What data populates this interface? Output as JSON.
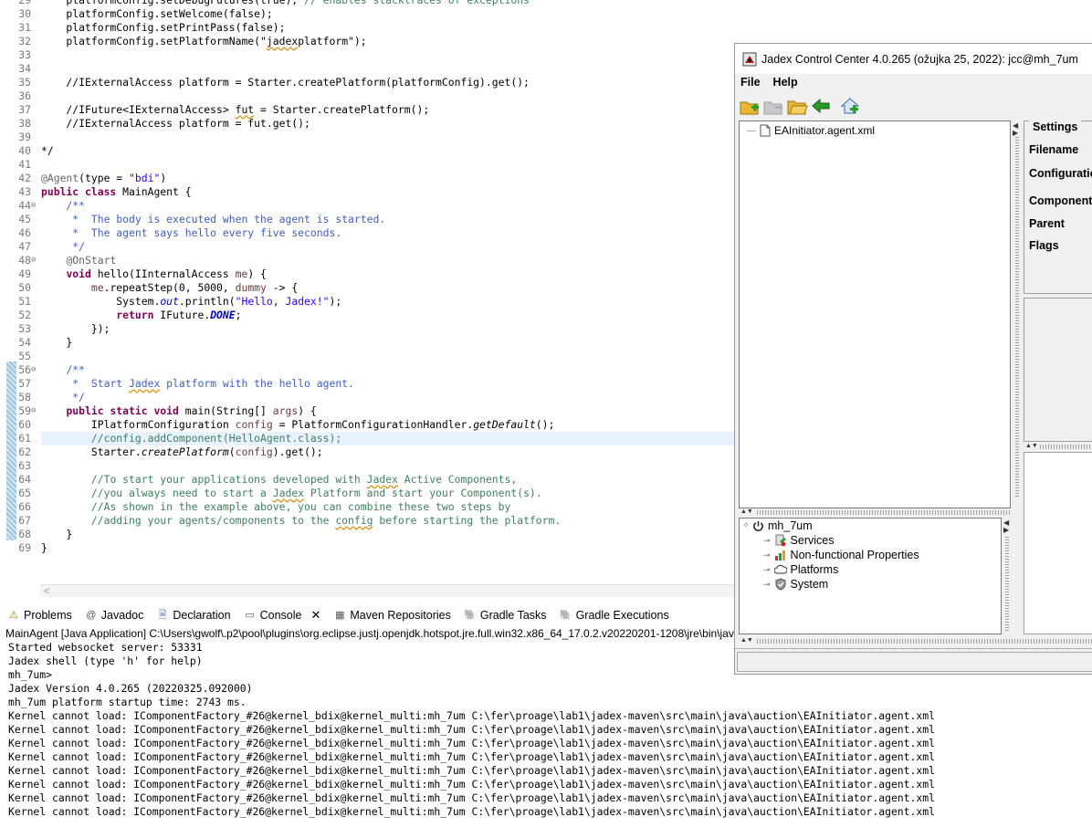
{
  "editor": {
    "lines": [
      {
        "n": "29",
        "html": "    platformConfig.setDebugFutures(true); <span class=\"cm\">// enables stacktraces of exceptions</span>"
      },
      {
        "n": "30",
        "html": "    platformConfig.setWelcome(false);"
      },
      {
        "n": "31",
        "html": "    platformConfig.setPrintPass(false);"
      },
      {
        "n": "32",
        "html": "    platformConfig.setPlatformName(\"<span class=\"sq\">jadex</span>platform\");"
      },
      {
        "n": "33",
        "html": ""
      },
      {
        "n": "34",
        "html": ""
      },
      {
        "n": "35",
        "html": "    //IExternalAccess platform = Starter.createPlatform(platformConfig).get();"
      },
      {
        "n": "36",
        "html": ""
      },
      {
        "n": "37",
        "html": "    //IFuture&lt;IExternalAccess&gt; <span class=\"sq\">fut</span> = Starter.createPlatform();"
      },
      {
        "n": "38",
        "html": "    //IExternalAccess platform = fut.get();"
      },
      {
        "n": "39",
        "html": ""
      },
      {
        "n": "40",
        "html": "*/"
      },
      {
        "n": "41",
        "html": ""
      },
      {
        "n": "42",
        "html": "<span class=\"an\">@Agent</span>(type = <span class=\"st\">\"bdi\"</span>)"
      },
      {
        "n": "43",
        "html": "<span class=\"kw\">public class</span> MainAgent {"
      },
      {
        "n": "44",
        "fold": "⊖",
        "html": "    <span class=\"jd\">/**</span>"
      },
      {
        "n": "45",
        "html": "    <span class=\"jd\"> *  The body is executed when the agent is started.</span>"
      },
      {
        "n": "46",
        "html": "    <span class=\"jd\"> *  The agent says hello every five seconds.</span>"
      },
      {
        "n": "47",
        "html": "    <span class=\"jd\"> */</span>"
      },
      {
        "n": "48",
        "fold": "⊖",
        "html": "    <span class=\"an\">@OnStart</span>"
      },
      {
        "n": "49",
        "html": "    <span class=\"kw\">void</span> hello(IInternalAccess <span class=\"va\">me</span>) {"
      },
      {
        "n": "50",
        "html": "        <span class=\"va\">me</span>.repeatStep(0, 5000, <span class=\"va\">dummy</span> -&gt; {"
      },
      {
        "n": "51",
        "html": "            System.<span class=\"fi\">out</span>.println(<span class=\"st\">\"Hello, Jadex!\"</span>);"
      },
      {
        "n": "52",
        "html": "            <span class=\"kw\">return</span> IFuture.<span class=\"fi\"><b>DONE</b></span>;"
      },
      {
        "n": "53",
        "html": "        });"
      },
      {
        "n": "54",
        "html": "    }"
      },
      {
        "n": "55",
        "html": ""
      },
      {
        "n": "56",
        "fold": "⊖",
        "html": "    <span class=\"jd\">/**</span>"
      },
      {
        "n": "57",
        "html": "    <span class=\"jd\"> *  Start <span class=\"sq\">Jadex</span> platform with the hello agent.</span>"
      },
      {
        "n": "58",
        "html": "    <span class=\"jd\"> */</span>"
      },
      {
        "n": "59",
        "fold": "⊖",
        "html": "    <span class=\"kw\">public static void</span> main(String[] <span class=\"va\">args</span>) {"
      },
      {
        "n": "60",
        "html": "        IPlatformConfiguration <span class=\"va\">config</span> = PlatformConfigurationHandler.<span class=\"mi\">getDefault</span>();"
      },
      {
        "n": "61",
        "hl": true,
        "html": "        <span class=\"cm\">//config.addComponent(HelloAgent.class);</span>"
      },
      {
        "n": "62",
        "html": "        Starter.<span class=\"mi\">createPlatform</span>(<span class=\"va\">config</span>).get();"
      },
      {
        "n": "63",
        "html": ""
      },
      {
        "n": "64",
        "html": "        <span class=\"cm\">//To start your applications developed with <span class=\"sq\">Jadex</span> Active Components,</span>"
      },
      {
        "n": "65",
        "html": "        <span class=\"cm\">//you always need to start a <span class=\"sq\">Jadex</span> Platform and start your Component(s).</span>"
      },
      {
        "n": "66",
        "html": "        <span class=\"cm\">//As shown in the example above, you can combine these two steps by</span>"
      },
      {
        "n": "67",
        "html": "        <span class=\"cm\">//adding your agents/components to the <span class=\"sq\">config</span> before starting the platform.</span>"
      },
      {
        "n": "68",
        "html": "    }"
      },
      {
        "n": "69",
        "html": "}"
      }
    ],
    "scroll_arrow": "<"
  },
  "views": {
    "tabs": [
      {
        "label": "Problems",
        "icon": "problems-icon",
        "glyph": "⚠",
        "color": "#c07000"
      },
      {
        "label": "Javadoc",
        "icon": "javadoc-icon",
        "glyph": "@",
        "color": "#555555"
      },
      {
        "label": "Declaration",
        "icon": "declaration-icon",
        "glyph": "🗎",
        "color": "#3c6ea8"
      },
      {
        "label": "Console",
        "icon": "console-icon",
        "glyph": "▭",
        "color": "#2f5b8a",
        "active": true
      },
      {
        "label": "Maven Repositories",
        "icon": "maven-icon",
        "glyph": "▦",
        "color": "#555555"
      },
      {
        "label": "Gradle Tasks",
        "icon": "gradle-tasks-icon",
        "glyph": "🐘",
        "color": "#1f4f4f"
      },
      {
        "label": "Gradle Executions",
        "icon": "gradle-executions-icon",
        "glyph": "🐘",
        "color": "#1f4f4f"
      }
    ],
    "close_glyph": "✕"
  },
  "console": {
    "header": "MainAgent [Java Application] C:\\Users\\gwolf\\.p2\\pool\\plugins\\org.eclipse.justj.openjdk.hotspot.jre.full.win32.x86_64_17.0.2.v20220201-1208\\jre\\bin\\javaw.exe",
    "lines": [
      "Started websocket server: 53331",
      "Jadex shell (type 'h' for help)",
      "mh_7um>",
      "Jadex Version 4.0.265 (20220325.092000)",
      "mh_7um platform startup time: 2743 ms.",
      "Kernel cannot load: IComponentFactory_#26@kernel_bdix@kernel_multi:mh_7um C:\\fer\\proage\\lab1\\jadex-maven\\src\\main\\java\\auction\\EAInitiator.agent.xml",
      "Kernel cannot load: IComponentFactory_#26@kernel_bdix@kernel_multi:mh_7um C:\\fer\\proage\\lab1\\jadex-maven\\src\\main\\java\\auction\\EAInitiator.agent.xml",
      "Kernel cannot load: IComponentFactory_#26@kernel_bdix@kernel_multi:mh_7um C:\\fer\\proage\\lab1\\jadex-maven\\src\\main\\java\\auction\\EAInitiator.agent.xml",
      "Kernel cannot load: IComponentFactory_#26@kernel_bdix@kernel_multi:mh_7um C:\\fer\\proage\\lab1\\jadex-maven\\src\\main\\java\\auction\\EAInitiator.agent.xml",
      "Kernel cannot load: IComponentFactory_#26@kernel_bdix@kernel_multi:mh_7um C:\\fer\\proage\\lab1\\jadex-maven\\src\\main\\java\\auction\\EAInitiator.agent.xml",
      "Kernel cannot load: IComponentFactory_#26@kernel_bdix@kernel_multi:mh_7um C:\\fer\\proage\\lab1\\jadex-maven\\src\\main\\java\\auction\\EAInitiator.agent.xml",
      "Kernel cannot load: IComponentFactory_#26@kernel_bdix@kernel_multi:mh_7um C:\\fer\\proage\\lab1\\jadex-maven\\src\\main\\java\\auction\\EAInitiator.agent.xml",
      "Kernel cannot load: IComponentFactory_#26@kernel_bdix@kernel_multi:mh_7um C:\\fer\\proage\\lab1\\jadex-maven\\src\\main\\java\\auction\\EAInitiator.agent.xml"
    ]
  },
  "jcc": {
    "title": "Jadex Control Center 4.0.265 (ožujka 25, 2022): jcc@mh_7um",
    "menu": [
      "File",
      "Help"
    ],
    "toolbar_icons": [
      "add-folder-icon",
      "remove-folder-icon",
      "open-folder-icon",
      "back-arrow-icon",
      "add-home-icon"
    ],
    "file_tree": {
      "file": "EAInitiator.agent.xml"
    },
    "platform_tree": {
      "root": "mh_7um",
      "children": [
        "Services",
        "Non-functional Properties",
        "Platforms",
        "System"
      ]
    },
    "settings": {
      "legend": "Settings",
      "labels": [
        "Filename",
        "Configuration",
        "Component name",
        "Parent",
        "Flags"
      ]
    }
  }
}
